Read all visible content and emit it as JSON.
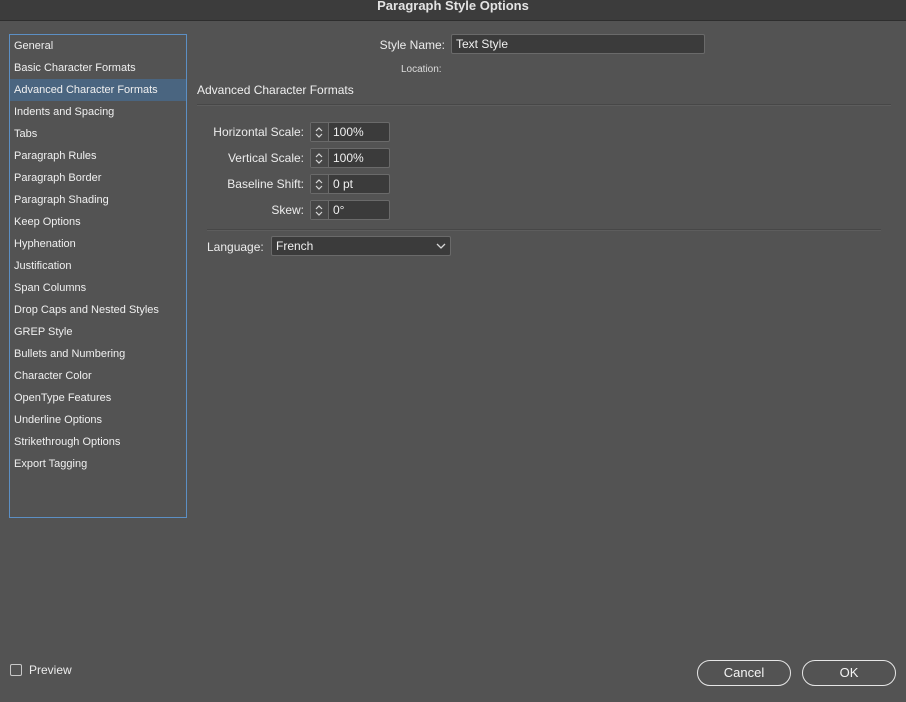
{
  "window": {
    "title": "Paragraph Style Options"
  },
  "sidebar": {
    "items": [
      {
        "label": "General"
      },
      {
        "label": "Basic Character Formats"
      },
      {
        "label": "Advanced Character Formats",
        "selected": true
      },
      {
        "label": "Indents and Spacing"
      },
      {
        "label": "Tabs"
      },
      {
        "label": "Paragraph Rules"
      },
      {
        "label": "Paragraph Border"
      },
      {
        "label": "Paragraph Shading"
      },
      {
        "label": "Keep Options"
      },
      {
        "label": "Hyphenation"
      },
      {
        "label": "Justification"
      },
      {
        "label": "Span Columns"
      },
      {
        "label": "Drop Caps and Nested Styles"
      },
      {
        "label": "GREP Style"
      },
      {
        "label": "Bullets and Numbering"
      },
      {
        "label": "Character Color"
      },
      {
        "label": "OpenType Features"
      },
      {
        "label": "Underline Options"
      },
      {
        "label": "Strikethrough Options"
      },
      {
        "label": "Export Tagging"
      }
    ]
  },
  "header": {
    "style_name_label": "Style Name:",
    "style_name_value": "Text Style",
    "location_label": "Location:"
  },
  "section": {
    "title": "Advanced Character Formats",
    "fields": {
      "horizontal_scale": {
        "label": "Horizontal Scale:",
        "value": "100%"
      },
      "vertical_scale": {
        "label": "Vertical Scale:",
        "value": "100%"
      },
      "baseline_shift": {
        "label": "Baseline Shift:",
        "value": "0 pt"
      },
      "skew": {
        "label": "Skew:",
        "value": "0°"
      }
    },
    "language": {
      "label": "Language:",
      "value": "French"
    }
  },
  "footer": {
    "preview_label": "Preview",
    "preview_checked": false,
    "cancel_label": "Cancel",
    "ok_label": "OK"
  },
  "colors": {
    "background": "#535353",
    "selection": "#4a6580",
    "sidebar_border": "#5c8fc4"
  }
}
